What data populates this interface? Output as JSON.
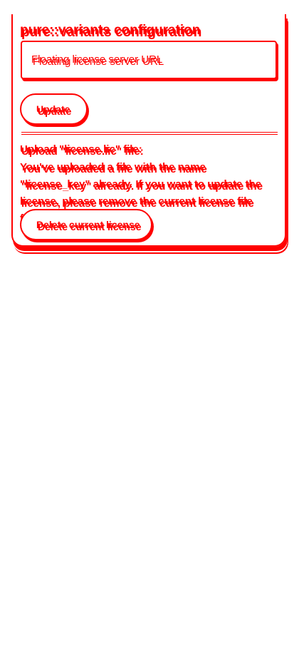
{
  "page": {
    "title": "pure::variants configuration"
  },
  "license_server": {
    "placeholder": "Floating license server URL",
    "update_label": "Update"
  },
  "license_file": {
    "upload_label": "Upload \"license.lic\" file:",
    "notice": "You've uploaded a file with the name \"license_key\" already. If you want to update the license, please remove the current license file first.",
    "delete_label": "Delete current license"
  },
  "colors": {
    "accent": "#ff0000",
    "background": "#ffffff"
  }
}
